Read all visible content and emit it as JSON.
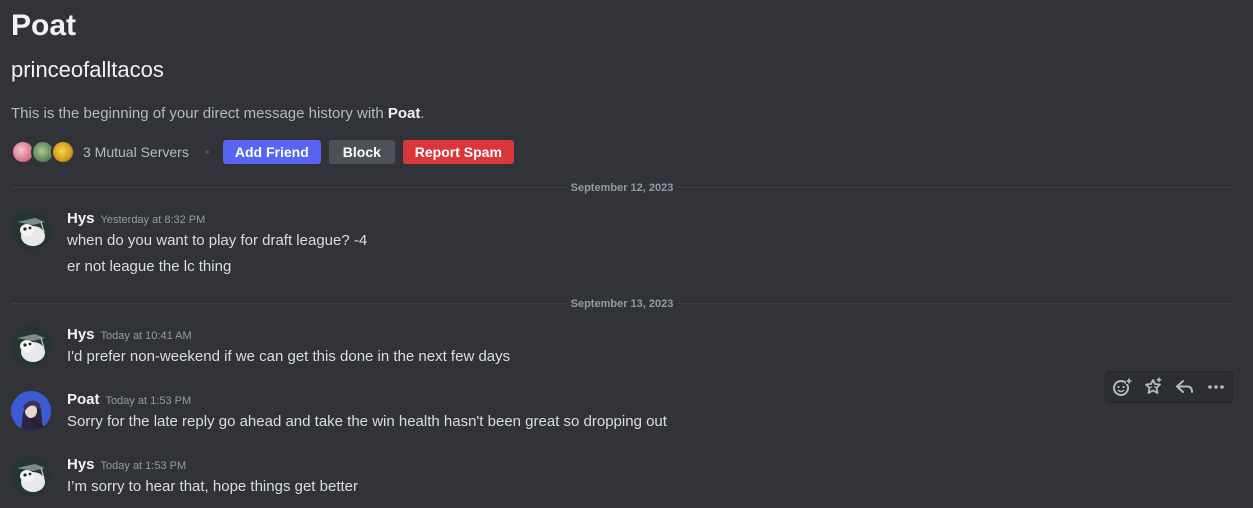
{
  "profile": {
    "display_name": "Poat",
    "username": "princeofalltacos",
    "intro_prefix": "This is the beginning of your direct message history with ",
    "intro_name": "Poat",
    "intro_suffix": "."
  },
  "actions": {
    "mutual_servers": "3 Mutual Servers",
    "add_friend": "Add Friend",
    "block": "Block",
    "report_spam": "Report Spam"
  },
  "dividers": [
    "September 12, 2023",
    "September 13, 2023"
  ],
  "messages": [
    {
      "author": "Hys",
      "timestamp": "Yesterday at 8:32 PM",
      "lines": [
        "when do you want to play for draft league? -4",
        "er not league the lc thing"
      ]
    },
    {
      "author": "Hys",
      "timestamp": "Today at 10:41 AM",
      "lines": [
        "I'd prefer non-weekend if we can get this done in the next few days"
      ]
    },
    {
      "author": "Poat",
      "timestamp": "Today at 1:53 PM",
      "lines": [
        "Sorry for the late reply go ahead and take the win health hasn't been great so dropping out"
      ]
    },
    {
      "author": "Hys",
      "timestamp": "Today at 1:53 PM",
      "lines": [
        "I’m sorry to hear that, hope things get better"
      ]
    }
  ],
  "hover_toolbar": [
    "add-reaction-icon",
    "super-reaction-icon",
    "reply-icon",
    "more-icon"
  ],
  "colors": {
    "background": "#313338",
    "blurple": "#5865f2",
    "danger": "#da373c",
    "secondary": "#4e5058"
  }
}
